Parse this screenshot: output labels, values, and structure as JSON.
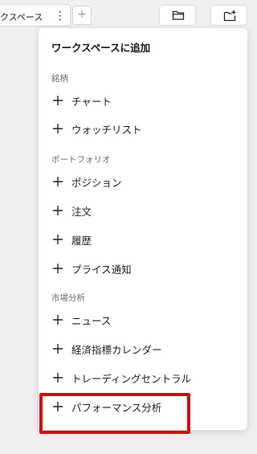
{
  "tabbar": {
    "tab_label": "クスペース",
    "kebab": "⋮",
    "add": "+"
  },
  "toolbar": {
    "folder_icon": "folder-icon",
    "new_workspace_icon": "folder-plus-icon"
  },
  "menu": {
    "title": "ワークスペースに追加",
    "sections": [
      {
        "label": "銘柄",
        "items": [
          "チャート",
          "ウォッチリスト"
        ]
      },
      {
        "label": "ポートフォリオ",
        "items": [
          "ポジション",
          "注文",
          "履歴",
          "プライス通知"
        ]
      },
      {
        "label": "市場分析",
        "items": [
          "ニュース",
          "経済指標カレンダー",
          "トレーディングセントラル",
          "パフォーマンス分析"
        ]
      }
    ]
  },
  "colors": {
    "highlight": "#d10a0a",
    "background": "#f0f0f0"
  }
}
